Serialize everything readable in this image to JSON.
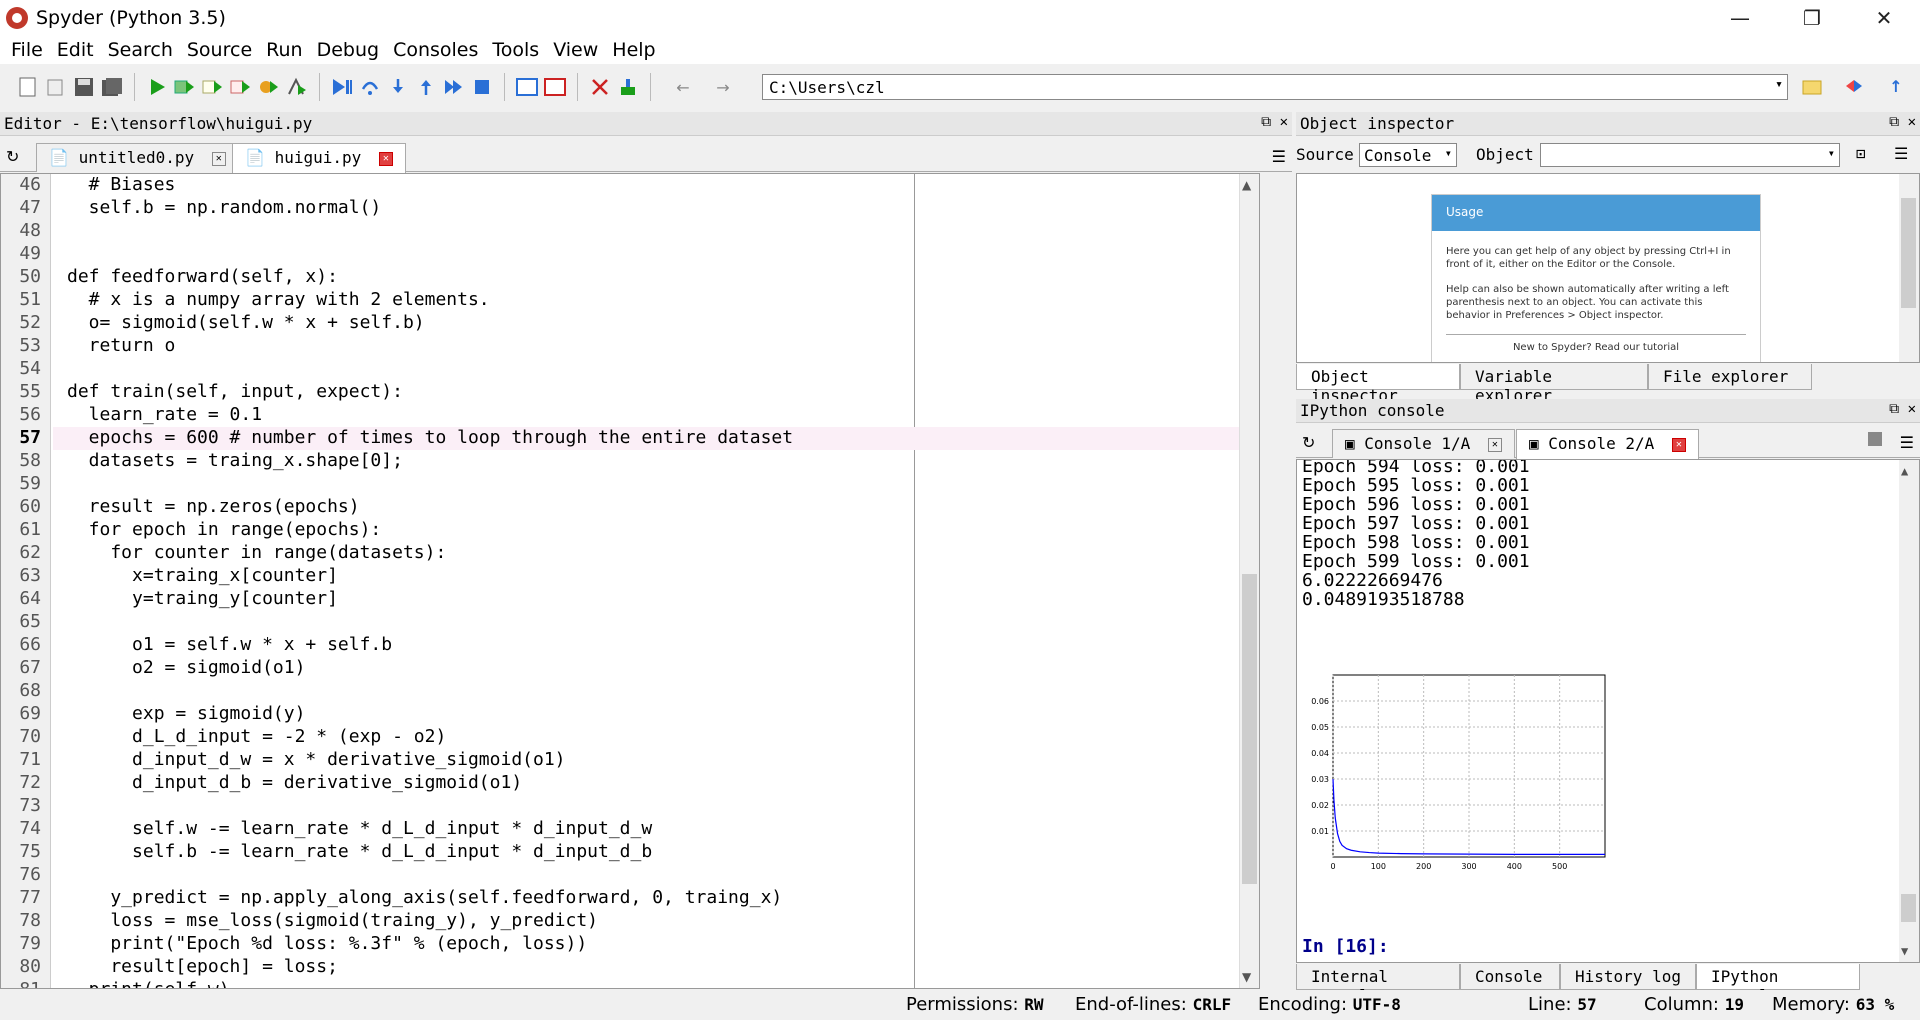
{
  "window": {
    "title": "Spyder (Python 3.5)",
    "minimize": "—",
    "maximize": "❐",
    "close": "✕"
  },
  "menu": [
    "File",
    "Edit",
    "Search",
    "Source",
    "Run",
    "Debug",
    "Consoles",
    "Tools",
    "View",
    "Help"
  ],
  "toolbar": {
    "path": "C:\\Users\\czl"
  },
  "editor": {
    "title": "Editor - E:\\tensorflow\\huigui.py",
    "tabs": [
      {
        "label": "untitled0.py"
      },
      {
        "label": "huigui.py"
      }
    ],
    "lines": [
      {
        "n": "46",
        "t": "  # Biases"
      },
      {
        "n": "47",
        "t": "  self.b = np.random.normal()"
      },
      {
        "n": "48",
        "t": ""
      },
      {
        "n": "49",
        "t": ""
      },
      {
        "n": "50",
        "t": "def feedforward(self, x):"
      },
      {
        "n": "51",
        "t": "  # x is a numpy array with 2 elements."
      },
      {
        "n": "52",
        "t": "  o= sigmoid(self.w * x + self.b)"
      },
      {
        "n": "53",
        "t": "  return o"
      },
      {
        "n": "54",
        "t": ""
      },
      {
        "n": "55",
        "t": "def train(self, input, expect):"
      },
      {
        "n": "56",
        "t": "  learn_rate = 0.1"
      },
      {
        "n": "57",
        "t": "  epochs = 600 # number of times to loop through the entire dataset"
      },
      {
        "n": "58",
        "t": "  datasets = traing_x.shape[0];"
      },
      {
        "n": "59",
        "t": ""
      },
      {
        "n": "60",
        "t": "  result = np.zeros(epochs)"
      },
      {
        "n": "61",
        "t": "  for epoch in range(epochs):"
      },
      {
        "n": "62",
        "t": "    for counter in range(datasets):"
      },
      {
        "n": "63",
        "t": "      x=traing_x[counter]"
      },
      {
        "n": "64",
        "t": "      y=traing_y[counter]"
      },
      {
        "n": "65",
        "t": ""
      },
      {
        "n": "66",
        "t": "      o1 = self.w * x + self.b"
      },
      {
        "n": "67",
        "t": "      o2 = sigmoid(o1)"
      },
      {
        "n": "68",
        "t": ""
      },
      {
        "n": "69",
        "t": "      exp = sigmoid(y)"
      },
      {
        "n": "70",
        "t": "      d_L_d_input = -2 * (exp - o2)"
      },
      {
        "n": "71",
        "t": "      d_input_d_w = x * derivative_sigmoid(o1)"
      },
      {
        "n": "72",
        "t": "      d_input_d_b = derivative_sigmoid(o1)"
      },
      {
        "n": "73",
        "t": ""
      },
      {
        "n": "74",
        "t": "      self.w -= learn_rate * d_L_d_input * d_input_d_w"
      },
      {
        "n": "75",
        "t": "      self.b -= learn_rate * d_L_d_input * d_input_d_b"
      },
      {
        "n": "76",
        "t": ""
      },
      {
        "n": "77",
        "t": "    y_predict = np.apply_along_axis(self.feedforward, 0, traing_x)"
      },
      {
        "n": "78",
        "t": "    loss = mse_loss(sigmoid(traing_y), y_predict)"
      },
      {
        "n": "79",
        "t": "    print(\"Epoch %d loss: %.3f\" % (epoch, loss))"
      },
      {
        "n": "80",
        "t": "    result[epoch] = loss;"
      },
      {
        "n": "81",
        "t": "  print(self.w)"
      }
    ],
    "current_line": "57"
  },
  "object_inspector": {
    "title": "Object inspector",
    "source_label": "Source",
    "source_value": "Console",
    "object_label": "Object",
    "object_value": "",
    "usage_title": "Usage",
    "usage_p1": "Here you can get help of any object by pressing Ctrl+I in front of it, either on the Editor or the Console.",
    "usage_p2": "Help can also be shown automatically after writing a left parenthesis next to an object. You can activate this behavior in Preferences > Object inspector.",
    "usage_new": "New to Spyder? Read our tutorial",
    "tabs": [
      "Object inspector",
      "Variable explorer",
      "File explorer"
    ]
  },
  "ipython": {
    "title": "IPython console",
    "tabs": [
      {
        "label": "Console 1/A"
      },
      {
        "label": "Console 2/A"
      }
    ],
    "output": [
      "Epoch 594 loss: 0.001",
      "Epoch 595 loss: 0.001",
      "Epoch 596 loss: 0.001",
      "Epoch 597 loss: 0.001",
      "Epoch 598 loss: 0.001",
      "Epoch 599 loss: 0.001",
      "6.02222669476",
      "0.0489193518788"
    ],
    "prompt": "In [16]:",
    "bottom_tabs": [
      "Internal console",
      "Console",
      "History log",
      "IPython console"
    ]
  },
  "chart_data": {
    "type": "line",
    "title": "",
    "xlabel": "",
    "ylabel": "",
    "xlim": [
      0,
      600
    ],
    "ylim": [
      0,
      0.07
    ],
    "xticks": [
      "0",
      "100",
      "200",
      "300",
      "400",
      "500"
    ],
    "yticks": [
      "0.01",
      "0.02",
      "0.03",
      "0.04",
      "0.05",
      "0.06"
    ],
    "grid": true,
    "color": "#0000ff",
    "series": [
      {
        "x": [
          0,
          2,
          5,
          10,
          15,
          20,
          30,
          40,
          60,
          80,
          100,
          150,
          200,
          300,
          400,
          500,
          600
        ],
        "y": [
          0.03,
          0.022,
          0.015,
          0.009,
          0.006,
          0.0045,
          0.0032,
          0.0026,
          0.002,
          0.0017,
          0.0015,
          0.0013,
          0.0012,
          0.0011,
          0.001,
          0.001,
          0.001
        ]
      }
    ]
  },
  "status": {
    "permissions_label": "Permissions:",
    "permissions": "RW",
    "eol_label": "End-of-lines:",
    "eol": "CRLF",
    "encoding_label": "Encoding:",
    "encoding": "UTF-8",
    "line_label": "Line:",
    "line": "57",
    "column_label": "Column:",
    "column": "19",
    "memory_label": "Memory:",
    "memory": "63 %"
  }
}
